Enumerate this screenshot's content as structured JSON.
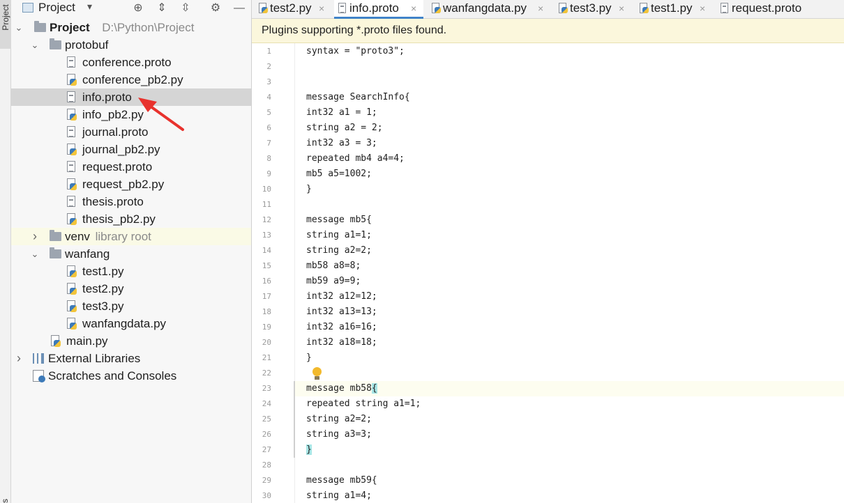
{
  "tool_stripe": {
    "top_label": "Project",
    "bottom_label": "rks"
  },
  "project_panel": {
    "title": "Project",
    "toolbar_icons": [
      "crosshair-icon",
      "expand-all-icon",
      "collapse-all-icon",
      "gear-icon",
      "minimize-icon"
    ],
    "tree": [
      {
        "label": "Project",
        "hint": "D:\\Python\\Project",
        "type": "folder",
        "expanded": true
      },
      {
        "label": "protobuf",
        "type": "folder",
        "expanded": true
      },
      {
        "label": "conference.proto",
        "type": "proto"
      },
      {
        "label": "conference_pb2.py",
        "type": "py"
      },
      {
        "label": "info.proto",
        "type": "proto",
        "selected": true
      },
      {
        "label": "info_pb2.py",
        "type": "py"
      },
      {
        "label": "journal.proto",
        "type": "proto"
      },
      {
        "label": "journal_pb2.py",
        "type": "py"
      },
      {
        "label": "request.proto",
        "type": "proto"
      },
      {
        "label": "request_pb2.py",
        "type": "py"
      },
      {
        "label": "thesis.proto",
        "type": "proto"
      },
      {
        "label": "thesis_pb2.py",
        "type": "py"
      },
      {
        "label": "venv",
        "hint": "library root",
        "type": "folder",
        "expanded": false
      },
      {
        "label": "wanfang",
        "type": "folder",
        "expanded": true
      },
      {
        "label": "test1.py",
        "type": "py"
      },
      {
        "label": "test2.py",
        "type": "py"
      },
      {
        "label": "test3.py",
        "type": "py"
      },
      {
        "label": "wanfangdata.py",
        "type": "py"
      },
      {
        "label": "main.py",
        "type": "py"
      },
      {
        "label": "External Libraries",
        "type": "libraries",
        "expanded": false
      },
      {
        "label": "Scratches and Consoles",
        "type": "scratches"
      }
    ]
  },
  "editor": {
    "tabs": [
      {
        "label": "test2.py",
        "type": "py",
        "active": false
      },
      {
        "label": "info.proto",
        "type": "proto",
        "active": true
      },
      {
        "label": "wanfangdata.py",
        "type": "py",
        "active": false
      },
      {
        "label": "test3.py",
        "type": "py",
        "active": false
      },
      {
        "label": "test1.py",
        "type": "py",
        "active": false
      },
      {
        "label": "request.proto",
        "type": "proto",
        "active": false
      }
    ],
    "close_glyph": "×",
    "banner": "Plugins supporting *.proto files found.",
    "current_line": 23,
    "lines": [
      "syntax = \"proto3\";",
      "",
      "",
      "message SearchInfo{",
      "int32 a1 = 1;",
      "string a2 = 2;",
      "int32 a3 = 3;",
      "repeated mb4 a4=4;",
      "mb5 a5=1002;",
      "}",
      "",
      "message mb5{",
      "string a1=1;",
      "string a2=2;",
      "mb58 a8=8;",
      "mb59 a9=9;",
      "int32 a12=12;",
      "int32 a13=13;",
      "int32 a16=16;",
      "int32 a18=18;",
      "}",
      "",
      "message mb58{",
      "repeated string a1=1;",
      "string a2=2;",
      "string a3=3;",
      "}",
      "",
      "message mb59{",
      "string a1=4;"
    ]
  },
  "colors": {
    "selection": "#d5d5d5",
    "banner_bg": "#fbf7dc",
    "brace_match": "#a8e6e6",
    "arrow_red": "#e8322d",
    "tab_accent": "#4083c9"
  }
}
